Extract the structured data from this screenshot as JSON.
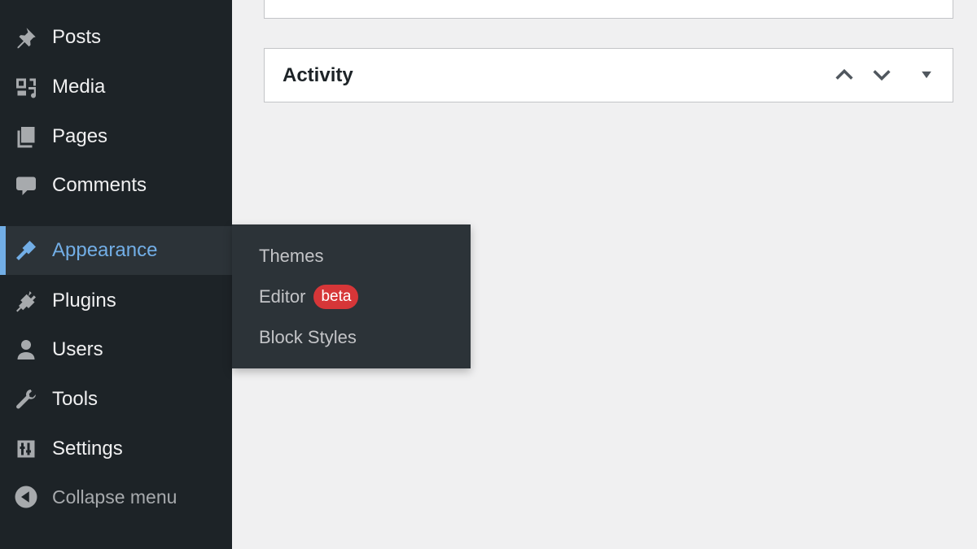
{
  "sidebar": {
    "items": [
      {
        "label": "Posts",
        "icon": "pin-icon"
      },
      {
        "label": "Media",
        "icon": "media-icon"
      },
      {
        "label": "Pages",
        "icon": "pages-icon"
      },
      {
        "label": "Comments",
        "icon": "comment-icon"
      },
      {
        "label": "Appearance",
        "icon": "paintbrush-icon",
        "active": true
      },
      {
        "label": "Plugins",
        "icon": "plugin-icon"
      },
      {
        "label": "Users",
        "icon": "user-icon"
      },
      {
        "label": "Tools",
        "icon": "wrench-icon"
      },
      {
        "label": "Settings",
        "icon": "settings-icon"
      }
    ],
    "collapse_label": "Collapse menu"
  },
  "flyout": {
    "items": [
      {
        "label": "Themes"
      },
      {
        "label": "Editor",
        "badge": "beta"
      },
      {
        "label": "Block Styles"
      }
    ]
  },
  "activity": {
    "title": "Activity"
  },
  "colors": {
    "sidebar_bg": "#1d2327",
    "flyout_bg": "#2c3338",
    "accent": "#72aee6",
    "badge": "#d63638",
    "page_bg": "#f0f0f1"
  }
}
